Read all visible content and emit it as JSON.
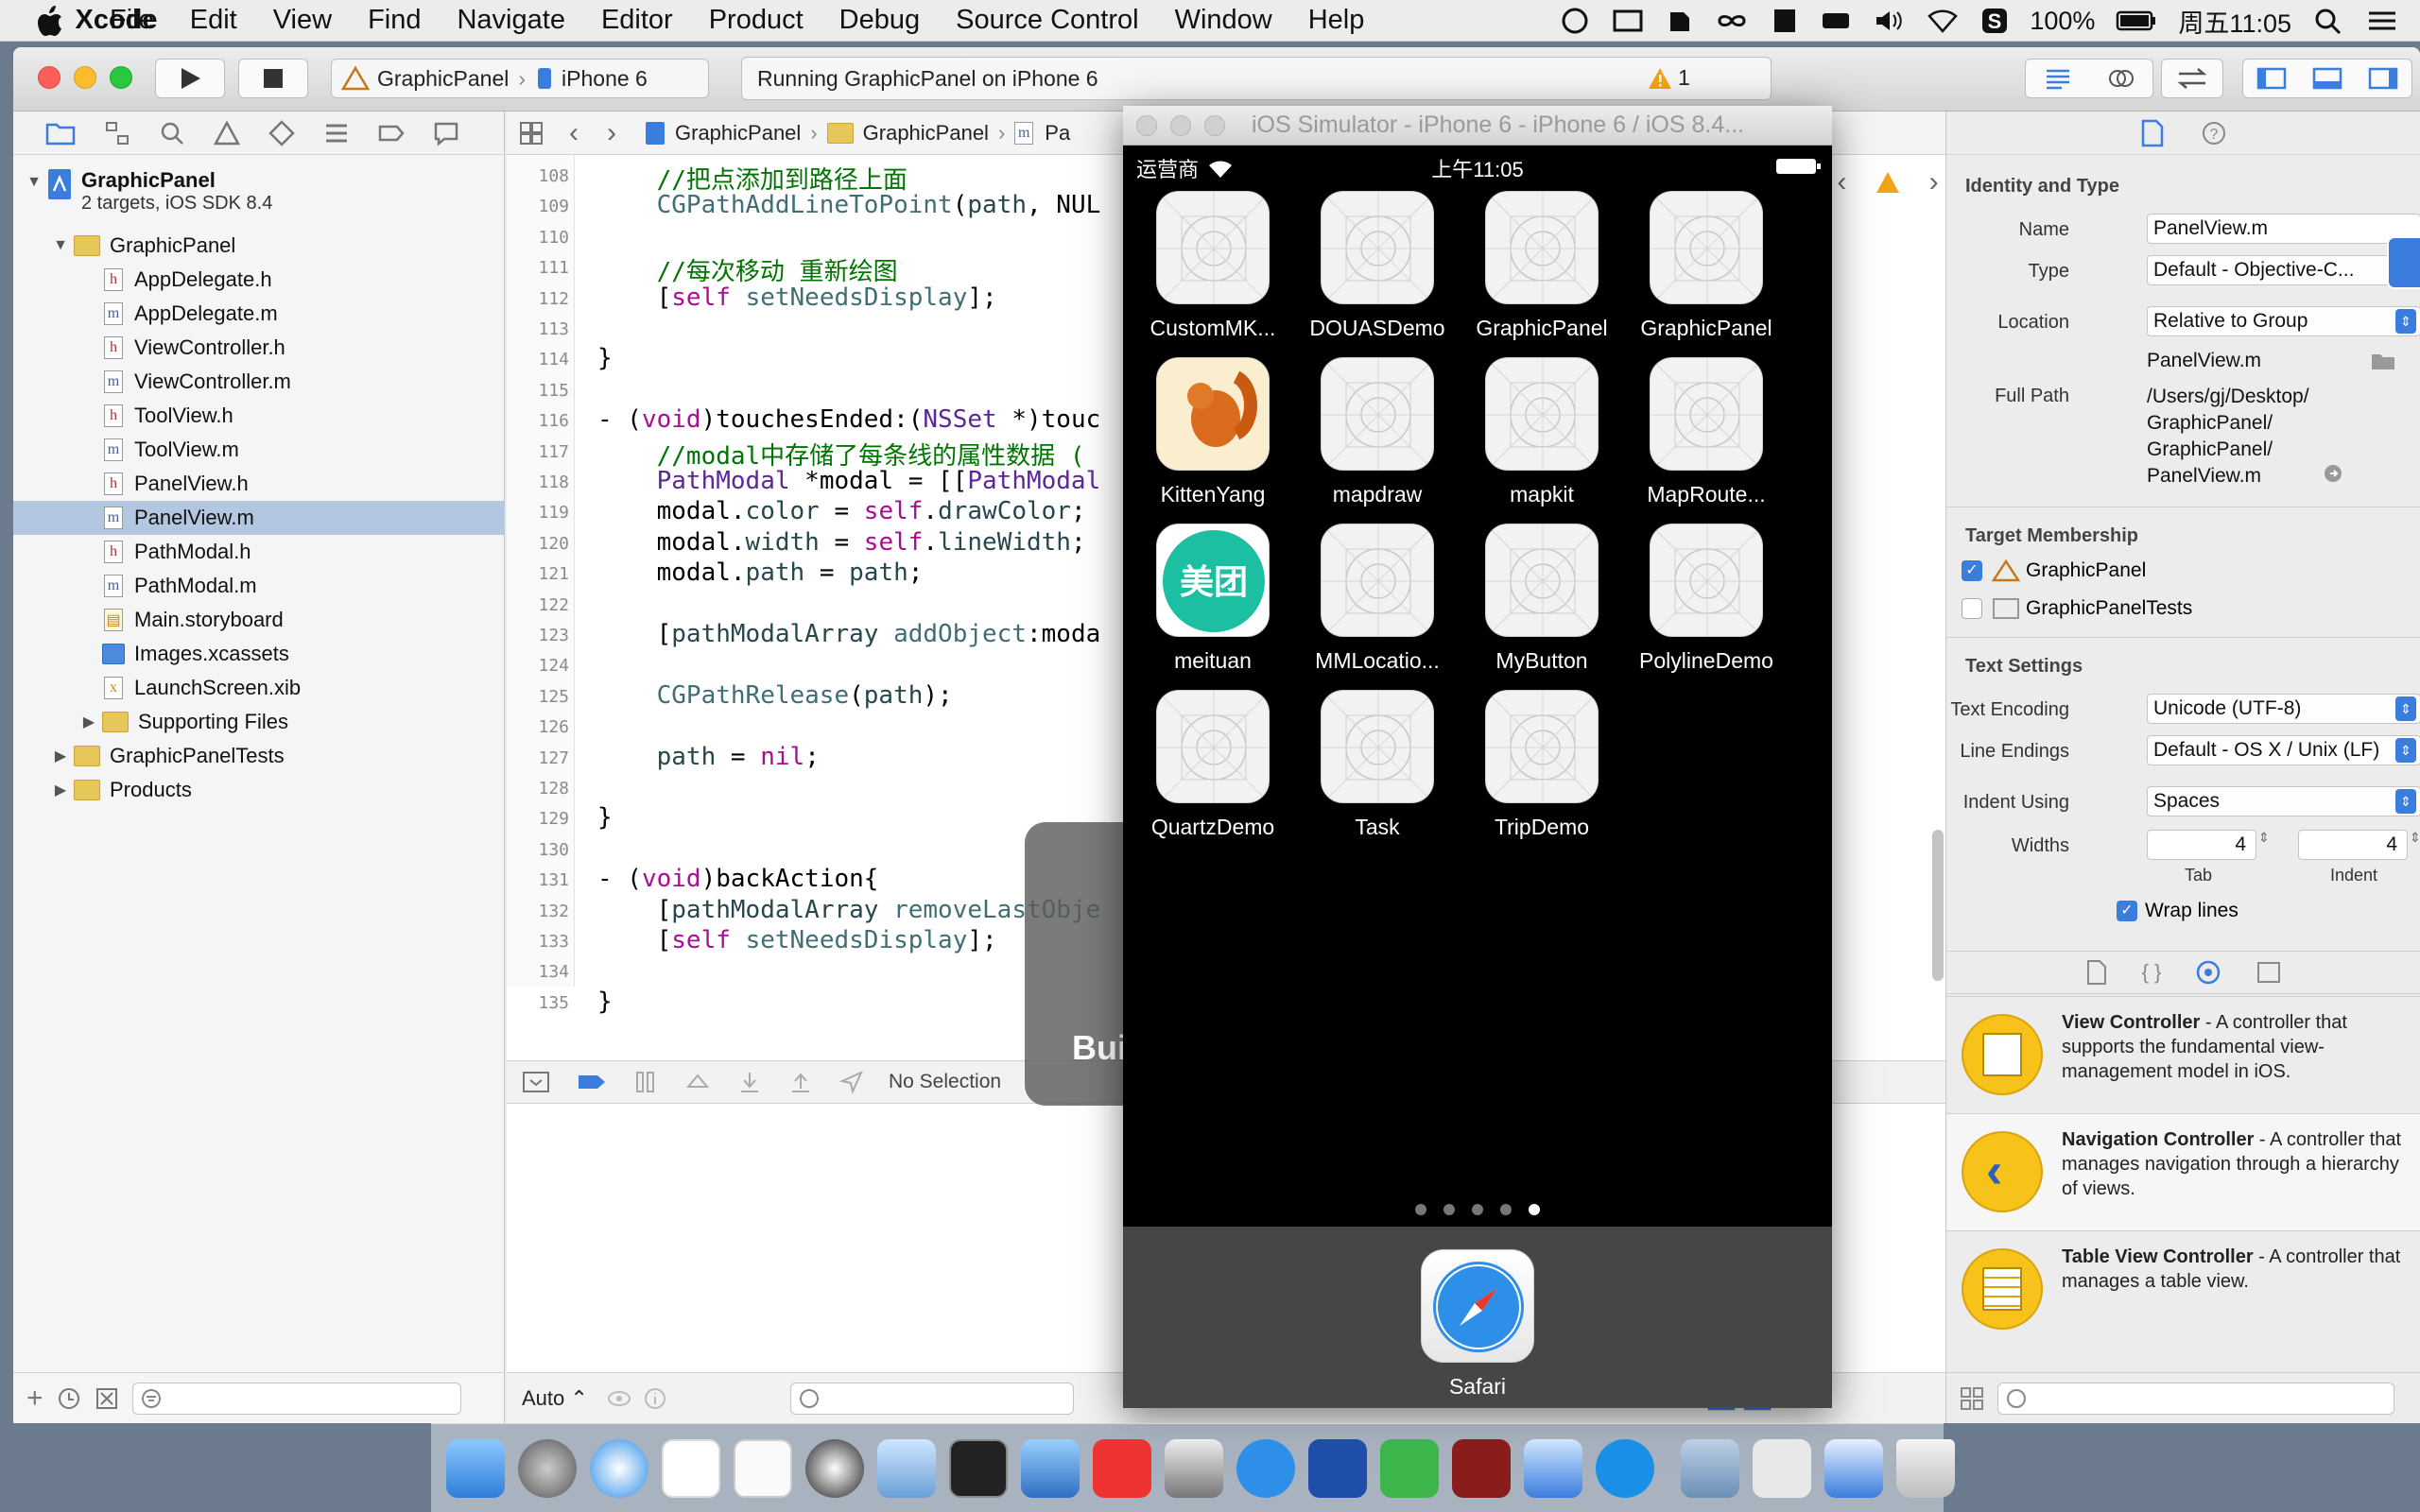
{
  "menubar": {
    "app": "Xcode",
    "items": [
      "File",
      "Edit",
      "View",
      "Find",
      "Navigate",
      "Editor",
      "Product",
      "Debug",
      "Source Control",
      "Window",
      "Help"
    ],
    "battery": "100%",
    "clock": "周五11:05"
  },
  "toolbar": {
    "scheme": "GraphicPanel",
    "device": "iPhone 6",
    "activity": "Running GraphicPanel on iPhone 6",
    "warnings": "1"
  },
  "navigator": {
    "project": "GraphicPanel",
    "project_sub": "2 targets, iOS SDK 8.4",
    "items": [
      {
        "label": "GraphicPanel",
        "kind": "group"
      },
      {
        "label": "AppDelegate.h",
        "kind": "h"
      },
      {
        "label": "AppDelegate.m",
        "kind": "m"
      },
      {
        "label": "ViewController.h",
        "kind": "h"
      },
      {
        "label": "ViewController.m",
        "kind": "m"
      },
      {
        "label": "ToolView.h",
        "kind": "h"
      },
      {
        "label": "ToolView.m",
        "kind": "m"
      },
      {
        "label": "PanelView.h",
        "kind": "h"
      },
      {
        "label": "PanelView.m",
        "kind": "m",
        "selected": true
      },
      {
        "label": "PathModal.h",
        "kind": "h"
      },
      {
        "label": "PathModal.m",
        "kind": "m"
      },
      {
        "label": "Main.storyboard",
        "kind": "sb"
      },
      {
        "label": "Images.xcassets",
        "kind": "folder"
      },
      {
        "label": "LaunchScreen.xib",
        "kind": "xib"
      },
      {
        "label": "Supporting Files",
        "kind": "group"
      },
      {
        "label": "GraphicPanelTests",
        "kind": "group"
      },
      {
        "label": "Products",
        "kind": "group"
      }
    ]
  },
  "editor": {
    "breadcrumb": [
      "GraphicPanel",
      "GraphicPanel",
      "Pa"
    ],
    "lines": [
      {
        "n": "108",
        "t": "    //把点添加到路径上面"
      },
      {
        "n": "109",
        "t": "    CGPathAddLineToPoint(path, NUL"
      },
      {
        "n": "110",
        "t": ""
      },
      {
        "n": "111",
        "t": "    //每次移动 重新绘图"
      },
      {
        "n": "112",
        "t": "    [self setNeedsDisplay];"
      },
      {
        "n": "113",
        "t": ""
      },
      {
        "n": "114",
        "t": "}"
      },
      {
        "n": "115",
        "t": ""
      },
      {
        "n": "116",
        "t": "- (void)touchesEnded:(NSSet *)touc"
      },
      {
        "n": "117",
        "t": "    //modal中存储了每条线的属性数据 ("
      },
      {
        "n": "118",
        "t": "    PathModal *modal = [[PathModal"
      },
      {
        "n": "119",
        "t": "    modal.color = self.drawColor;"
      },
      {
        "n": "120",
        "t": "    modal.width = self.lineWidth;"
      },
      {
        "n": "121",
        "t": "    modal.path = path;"
      },
      {
        "n": "122",
        "t": ""
      },
      {
        "n": "123",
        "t": "    [pathModalArray addObject:moda"
      },
      {
        "n": "124",
        "t": ""
      },
      {
        "n": "125",
        "t": "    CGPathRelease(path);"
      },
      {
        "n": "126",
        "t": ""
      },
      {
        "n": "127",
        "t": "    path = nil;"
      },
      {
        "n": "128",
        "t": ""
      },
      {
        "n": "129",
        "t": "}"
      },
      {
        "n": "130",
        "t": ""
      },
      {
        "n": "131",
        "t": "- (void)backAction{"
      },
      {
        "n": "132",
        "t": "    [pathModalArray removeLastObje"
      },
      {
        "n": "133",
        "t": "    [self setNeedsDisplay];"
      },
      {
        "n": "134",
        "t": ""
      },
      {
        "n": "135",
        "t": "}"
      }
    ],
    "debug_selection": "No Selection",
    "console_mode": "Auto"
  },
  "inspector": {
    "identity_title": "Identity and Type",
    "name_label": "Name",
    "name_value": "PanelView.m",
    "type_label": "Type",
    "type_value": "Default - Objective-C...",
    "location_label": "Location",
    "location_value": "Relative to Group",
    "location_file": "PanelView.m",
    "fullpath_label": "Full Path",
    "fullpath_lines": [
      "/Users/gj/Desktop/",
      "GraphicPanel/",
      "GraphicPanel/",
      "PanelView.m"
    ],
    "target_title": "Target Membership",
    "targets": [
      {
        "label": "GraphicPanel",
        "checked": true
      },
      {
        "label": "GraphicPanelTests",
        "checked": false
      }
    ],
    "text_title": "Text Settings",
    "encoding_label": "Text Encoding",
    "encoding_value": "Unicode (UTF-8)",
    "endings_label": "Line Endings",
    "endings_value": "Default - OS X / Unix (LF)",
    "indent_label": "Indent Using",
    "indent_value": "Spaces",
    "widths_label": "Widths",
    "tab_value": "4",
    "indent_width_value": "4",
    "tab_label": "Tab",
    "indent_sub_label": "Indent",
    "wrap_label": "Wrap lines",
    "library": [
      {
        "title": "View Controller",
        "desc": " - A controller that supports the fundamental view-management model in iOS."
      },
      {
        "title": "Navigation Controller",
        "desc": " - A controller that manages navigation through a hierarchy of views."
      },
      {
        "title": "Table View Controller",
        "desc": " - A controller that manages a table view."
      }
    ]
  },
  "simulator": {
    "title": "iOS Simulator - iPhone 6 - iPhone 6 / iOS 8.4...",
    "carrier": "运营商",
    "time": "上午11:05",
    "apps": [
      "CustomMK...",
      "DOUASDemo",
      "GraphicPanel",
      "GraphicPanel",
      "KittenYang",
      "mapdraw",
      "mapkit",
      "MapRoute...",
      "meituan",
      "MMLocatio...",
      "MyButton",
      "PolylineDemo",
      "QuartzDemo",
      "Task",
      "TripDemo"
    ],
    "meituan_icon_text": "美团",
    "dock_app": "Safari",
    "page_count": 5,
    "page_active": 5
  },
  "hud": {
    "label": "Build Succeeded"
  }
}
